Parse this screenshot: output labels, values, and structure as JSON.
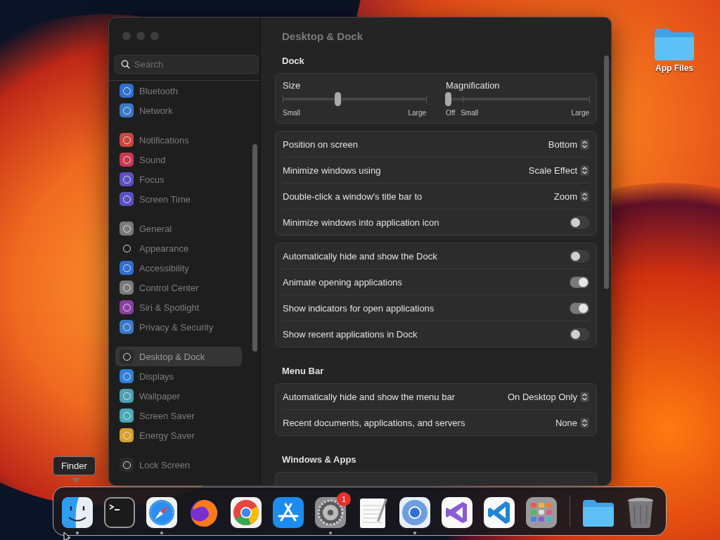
{
  "window": {
    "title": "Desktop & Dock"
  },
  "sidebar": {
    "search": {
      "placeholder": "Search"
    },
    "groups": [
      [
        {
          "label": "Bluetooth",
          "color": "#2f6fd0",
          "selected": false
        },
        {
          "label": "Network",
          "color": "#3a78c8",
          "selected": false
        }
      ],
      [
        {
          "label": "Notifications",
          "color": "#c8463e",
          "selected": false
        },
        {
          "label": "Sound",
          "color": "#c8384f",
          "selected": false
        },
        {
          "label": "Focus",
          "color": "#5a4fc0",
          "selected": false
        },
        {
          "label": "Screen Time",
          "color": "#5a4fc0",
          "selected": false
        }
      ],
      [
        {
          "label": "General",
          "color": "#7a7a7a",
          "selected": false
        },
        {
          "label": "Appearance",
          "color": "#1e1e1e",
          "selected": false
        },
        {
          "label": "Accessibility",
          "color": "#2f6fd0",
          "selected": false
        },
        {
          "label": "Control Center",
          "color": "#7a7a7a",
          "selected": false
        },
        {
          "label": "Siri & Spotlight",
          "color": "#8a3fa0",
          "selected": false
        },
        {
          "label": "Privacy & Security",
          "color": "#3a78c8",
          "selected": false
        }
      ],
      [
        {
          "label": "Desktop & Dock",
          "color": "#2a2a2a",
          "selected": true
        },
        {
          "label": "Displays",
          "color": "#2f7fd8",
          "selected": false
        },
        {
          "label": "Wallpaper",
          "color": "#4aa0b0",
          "selected": false
        },
        {
          "label": "Screen Saver",
          "color": "#4aa8b8",
          "selected": false
        },
        {
          "label": "Energy Saver",
          "color": "#d8a030",
          "selected": false
        }
      ],
      [
        {
          "label": "Lock Screen",
          "color": "#2a2a2a",
          "selected": false
        }
      ]
    ]
  },
  "content": {
    "sections": [
      {
        "heading": "Dock",
        "groups": [
          {
            "kind": "sliders",
            "sliders": [
              {
                "label": "Size",
                "level": 0.37,
                "ticks": [
                  "Small",
                  "Large"
                ]
              },
              {
                "label": "Magnification",
                "level": 0,
                "ticks": [
                  "Off",
                  "Small",
                  "Large"
                ]
              }
            ]
          },
          {
            "kind": "rows",
            "rows": [
              {
                "kind": "popup",
                "label": "Position on screen",
                "value": "Bottom"
              },
              {
                "kind": "popup",
                "label": "Minimize windows using",
                "value": "Scale Effect"
              },
              {
                "kind": "popup",
                "label": "Double-click a window's title bar to",
                "value": "Zoom"
              },
              {
                "kind": "toggle",
                "label": "Minimize windows into application icon",
                "on": false
              }
            ]
          },
          {
            "kind": "rows",
            "rows": [
              {
                "kind": "toggle",
                "label": "Automatically hide and show the Dock",
                "on": false
              },
              {
                "kind": "toggle",
                "label": "Animate opening applications",
                "on": true
              },
              {
                "kind": "toggle",
                "label": "Show indicators for open applications",
                "on": true
              },
              {
                "kind": "toggle",
                "label": "Show recent applications in Dock",
                "on": false
              }
            ]
          }
        ]
      },
      {
        "heading": "Menu Bar",
        "groups": [
          {
            "kind": "rows",
            "rows": [
              {
                "kind": "popup",
                "label": "Automatically hide and show the menu bar",
                "value": "On Desktop Only"
              },
              {
                "kind": "popup",
                "label": "Recent documents, applications, and servers",
                "value": "None"
              }
            ]
          }
        ]
      },
      {
        "heading": "Windows & Apps",
        "groups": [
          {
            "kind": "rows"
          }
        ]
      }
    ]
  },
  "desktop": {
    "items": [
      {
        "label": "App Files"
      }
    ]
  },
  "dock": {
    "tooltip": "Finder",
    "apps": [
      {
        "kind": "finder",
        "running": true
      },
      {
        "kind": "terminal",
        "running": false
      },
      {
        "kind": "safari",
        "running": true
      },
      {
        "kind": "firefox",
        "running": false
      },
      {
        "kind": "chrome",
        "running": false
      },
      {
        "kind": "appstore",
        "running": false
      },
      {
        "kind": "settings",
        "running": true,
        "badge": "1"
      },
      {
        "kind": "textedit",
        "running": false
      },
      {
        "kind": "chromium",
        "running": true
      },
      {
        "kind": "vs",
        "running": false
      },
      {
        "kind": "vscode",
        "running": false
      },
      {
        "kind": "launchpad",
        "running": false
      }
    ],
    "extras": [
      {
        "kind": "folder"
      },
      {
        "kind": "trash"
      }
    ]
  }
}
